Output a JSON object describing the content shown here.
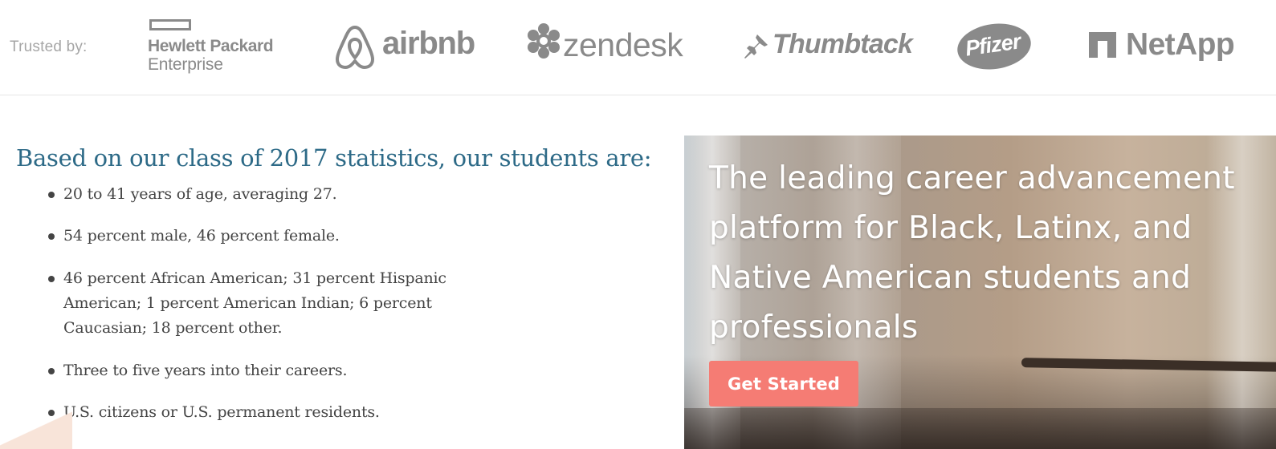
{
  "trusted": {
    "label": "Trusted by:",
    "logos": [
      {
        "name": "Hewlett Packard Enterprise",
        "line1": "Hewlett Packard",
        "line2": "Enterprise",
        "icon": "hpe-rectangle-icon"
      },
      {
        "name": "airbnb",
        "text": "airbnb",
        "icon": "airbnb-belo-icon"
      },
      {
        "name": "zendesk",
        "text": "zendesk",
        "icon": "zendesk-flower-icon"
      },
      {
        "name": "Thumbtack",
        "text": "Thumbtack",
        "icon": "pushpin-icon"
      },
      {
        "name": "Pfizer",
        "text": "Pfizer",
        "icon": "pfizer-oval-icon"
      },
      {
        "name": "NetApp",
        "text": "NetApp",
        "icon": "netapp-n-icon"
      }
    ],
    "logo_color": "#8a8a8a"
  },
  "stats": {
    "heading": "Based on our class of 2017 statistics, our students are:",
    "items": [
      "20 to 41 years of age, averaging 27.",
      "54 percent male, 46 percent female.",
      "46 percent African American; 31 percent Hispanic American; 1 percent American Indian; 6 percent Caucasian; 18 percent other.",
      "Three to five years into their careers.",
      "U.S. citizens or U.S. permanent residents."
    ],
    "heading_color": "#2d6a87"
  },
  "hero": {
    "title": "The leading career advancement platform for Black, Latinx, and Native American students and professionals",
    "cta_label": "Get Started",
    "cta_color": "#f57c74"
  }
}
